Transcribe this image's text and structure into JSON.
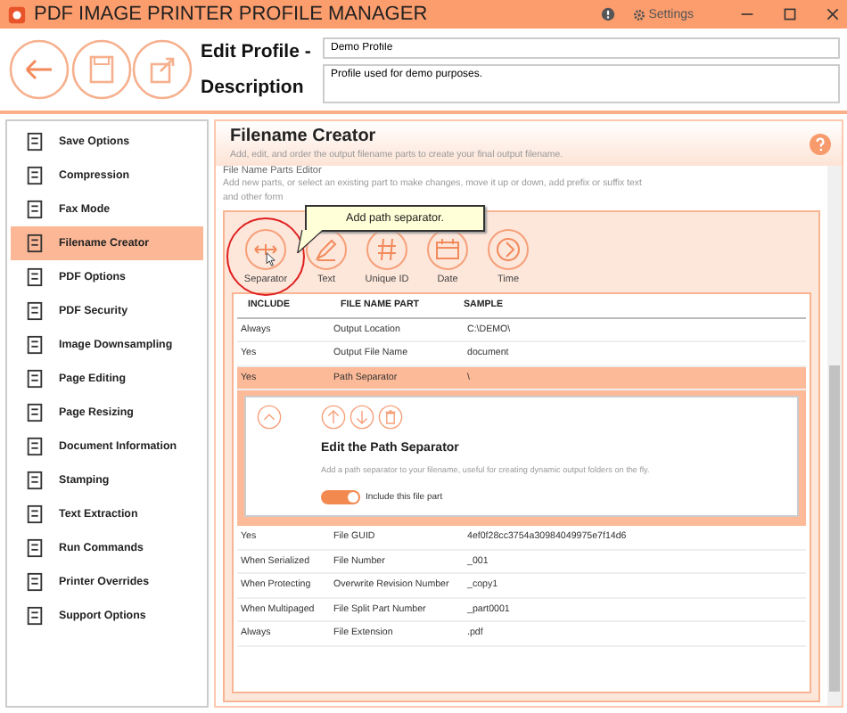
{
  "window": {
    "title": "PDF IMAGE PRINTER PROFILE MANAGER",
    "settings": "Settings"
  },
  "header": {
    "profile_label": "Edit Profile -",
    "profile_value": "Demo Profile",
    "description_label": "Description",
    "description_value": "Profile used for demo purposes."
  },
  "sidebar": {
    "items": [
      {
        "label": "Save Options",
        "selected": false
      },
      {
        "label": "Compression",
        "selected": false
      },
      {
        "label": "Fax Mode",
        "selected": false
      },
      {
        "label": "Filename Creator",
        "selected": true
      },
      {
        "label": "PDF Options",
        "selected": false
      },
      {
        "label": "PDF Security",
        "selected": false
      },
      {
        "label": "Image Downsampling",
        "selected": false
      },
      {
        "label": "Page Editing",
        "selected": false
      },
      {
        "label": "Page Resizing",
        "selected": false
      },
      {
        "label": "Document Information",
        "selected": false
      },
      {
        "label": "Stamping",
        "selected": false
      },
      {
        "label": "Text Extraction",
        "selected": false
      },
      {
        "label": "Run Commands",
        "selected": false
      },
      {
        "label": "Printer Overrides",
        "selected": false
      },
      {
        "label": "Support Options",
        "selected": false
      }
    ]
  },
  "panel": {
    "title": "Filename Creator",
    "subtitle": "Add, edit, and order the output filename parts to create your final output filename.",
    "section_title": "File Name Parts Editor",
    "hint": "Add new parts, or select an existing part to make changes, move it up or down, add prefix or suffix text",
    "hint_2": "and other form",
    "tooltip": "Add path separator.",
    "tools": [
      {
        "kind": "separator",
        "label": "Separator",
        "highlighted": true
      },
      {
        "kind": "text",
        "label": "Text",
        "highlighted": false
      },
      {
        "kind": "id",
        "label": "Unique ID",
        "highlighted": false
      },
      {
        "kind": "date",
        "label": "Date",
        "highlighted": false
      },
      {
        "kind": "time",
        "label": "Time",
        "highlighted": false
      }
    ],
    "columns": [
      "INCLUDE",
      "FILE NAME PART",
      "SAMPLE"
    ],
    "rows": [
      {
        "include": "Always",
        "part": "Output Location",
        "sample": "C:\\DEMO\\",
        "selected": false
      },
      {
        "include": "Yes",
        "part": "Output File Name",
        "sample": "document",
        "selected": false
      },
      {
        "include": "Yes",
        "part": "Path Separator",
        "sample": "\\",
        "selected": true,
        "detail": {
          "title": "Edit the Path Separator",
          "text": "Add a path separator to your filename, useful for creating dynamic output folders on the fly.",
          "toggle_label": "Include this file part",
          "on": true
        }
      },
      {
        "include": "Yes",
        "part": "File GUID",
        "sample": "4ef0f28cc3754a30984049975e7f14d6",
        "selected": false
      },
      {
        "include": "When Serialized",
        "part": "File Number",
        "sample": "_001",
        "selected": false
      },
      {
        "include": "When Protecting",
        "part": "Overwrite Revision Number",
        "sample": "_copy1",
        "selected": false
      },
      {
        "include": "When Multipaged",
        "part": "File Split Part Number",
        "sample": "_part0001",
        "selected": false
      },
      {
        "include": "Always",
        "part": "File Extension",
        "sample": ".pdf",
        "selected": false
      }
    ]
  }
}
